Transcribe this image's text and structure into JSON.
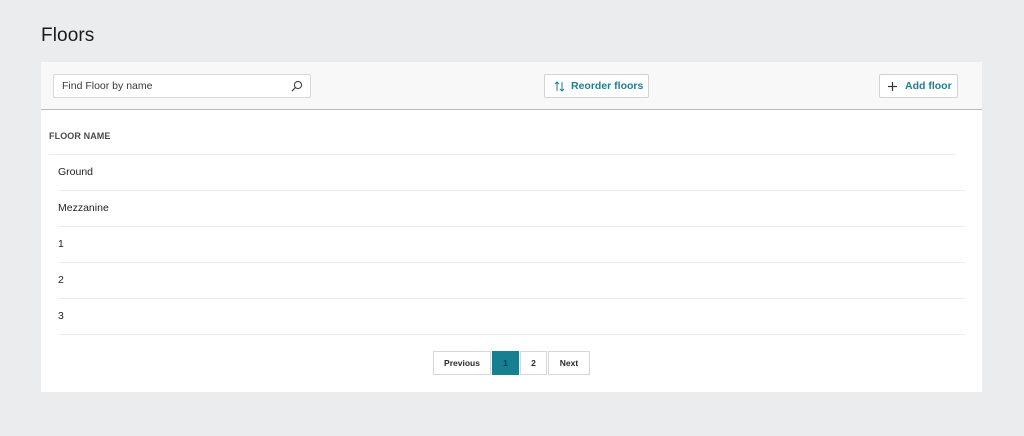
{
  "page": {
    "title": "Floors"
  },
  "toolbar": {
    "search_placeholder": "Find Floor by name",
    "reorder_label": "Reorder floors",
    "add_label": "Add floor"
  },
  "table": {
    "column_header": "FLOOR NAME",
    "rows": [
      "Ground",
      "Mezzanine",
      "1",
      "2",
      "3"
    ]
  },
  "pagination": {
    "previous_label": "Previous",
    "pages": [
      "1",
      "2"
    ],
    "current_page": "1",
    "next_label": "Next"
  },
  "colors": {
    "accent": "#1e7f91",
    "active_page": "#167f92",
    "background": "#ebecee"
  },
  "icons": {
    "search": "search-icon",
    "reorder": "sort-arrows-icon",
    "add": "plus-icon"
  }
}
